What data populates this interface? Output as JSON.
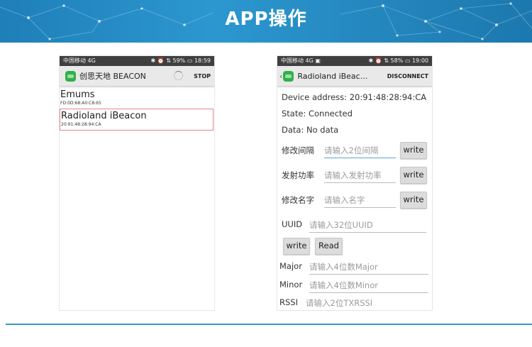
{
  "slide_title": "APP操作",
  "colors": {
    "banner": "#2c97cf",
    "status_bar": "#3f3f3f",
    "selected_border": "#e08a8a",
    "divider": "#3b92c9"
  },
  "phone_left": {
    "status": {
      "carrier": "中国移动 4G",
      "battery": "59%",
      "time": "18:59",
      "icons": "✱ ⏰ ⇅"
    },
    "actionbar": {
      "title": "创思天地 BEACON",
      "action": "STOP"
    },
    "devices": [
      {
        "name": "Emums",
        "address": "FD:0D:68:A0:C8:65"
      },
      {
        "name": "Radioland iBeacon",
        "address": "20:91:48:28:94:CA"
      }
    ]
  },
  "phone_right": {
    "status": {
      "carrier": "中国移动 4G ▣",
      "battery": "58%",
      "time": "19:00",
      "icons": "✱ ⏰ ⇅"
    },
    "actionbar": {
      "back": "‹",
      "title": "Radioland iBeac...",
      "action": "DISCONNECT"
    },
    "device_address": "Device address: 20:91:48:28:94:CA",
    "state": "State: Connected",
    "data": "Data: No data",
    "interval": {
      "label": "修改间隔",
      "placeholder": "请输入2位间隔",
      "button": "write"
    },
    "power": {
      "label": "发射功率",
      "placeholder": "请输入发射功率",
      "button": "write"
    },
    "name": {
      "label": "修改名字",
      "placeholder": "请输入名字",
      "button": "write"
    },
    "uuid": {
      "label": "UUID",
      "placeholder": "请输入32位UUID",
      "write_button": "write",
      "read_button": "Read"
    },
    "major": {
      "label": "Major",
      "placeholder": "请输入4位数Major"
    },
    "minor": {
      "label": "Minor",
      "placeholder": "请输入4位数Minor"
    },
    "rssi": {
      "label": "RSSI",
      "placeholder": "请输入2位TXRSSI"
    }
  }
}
